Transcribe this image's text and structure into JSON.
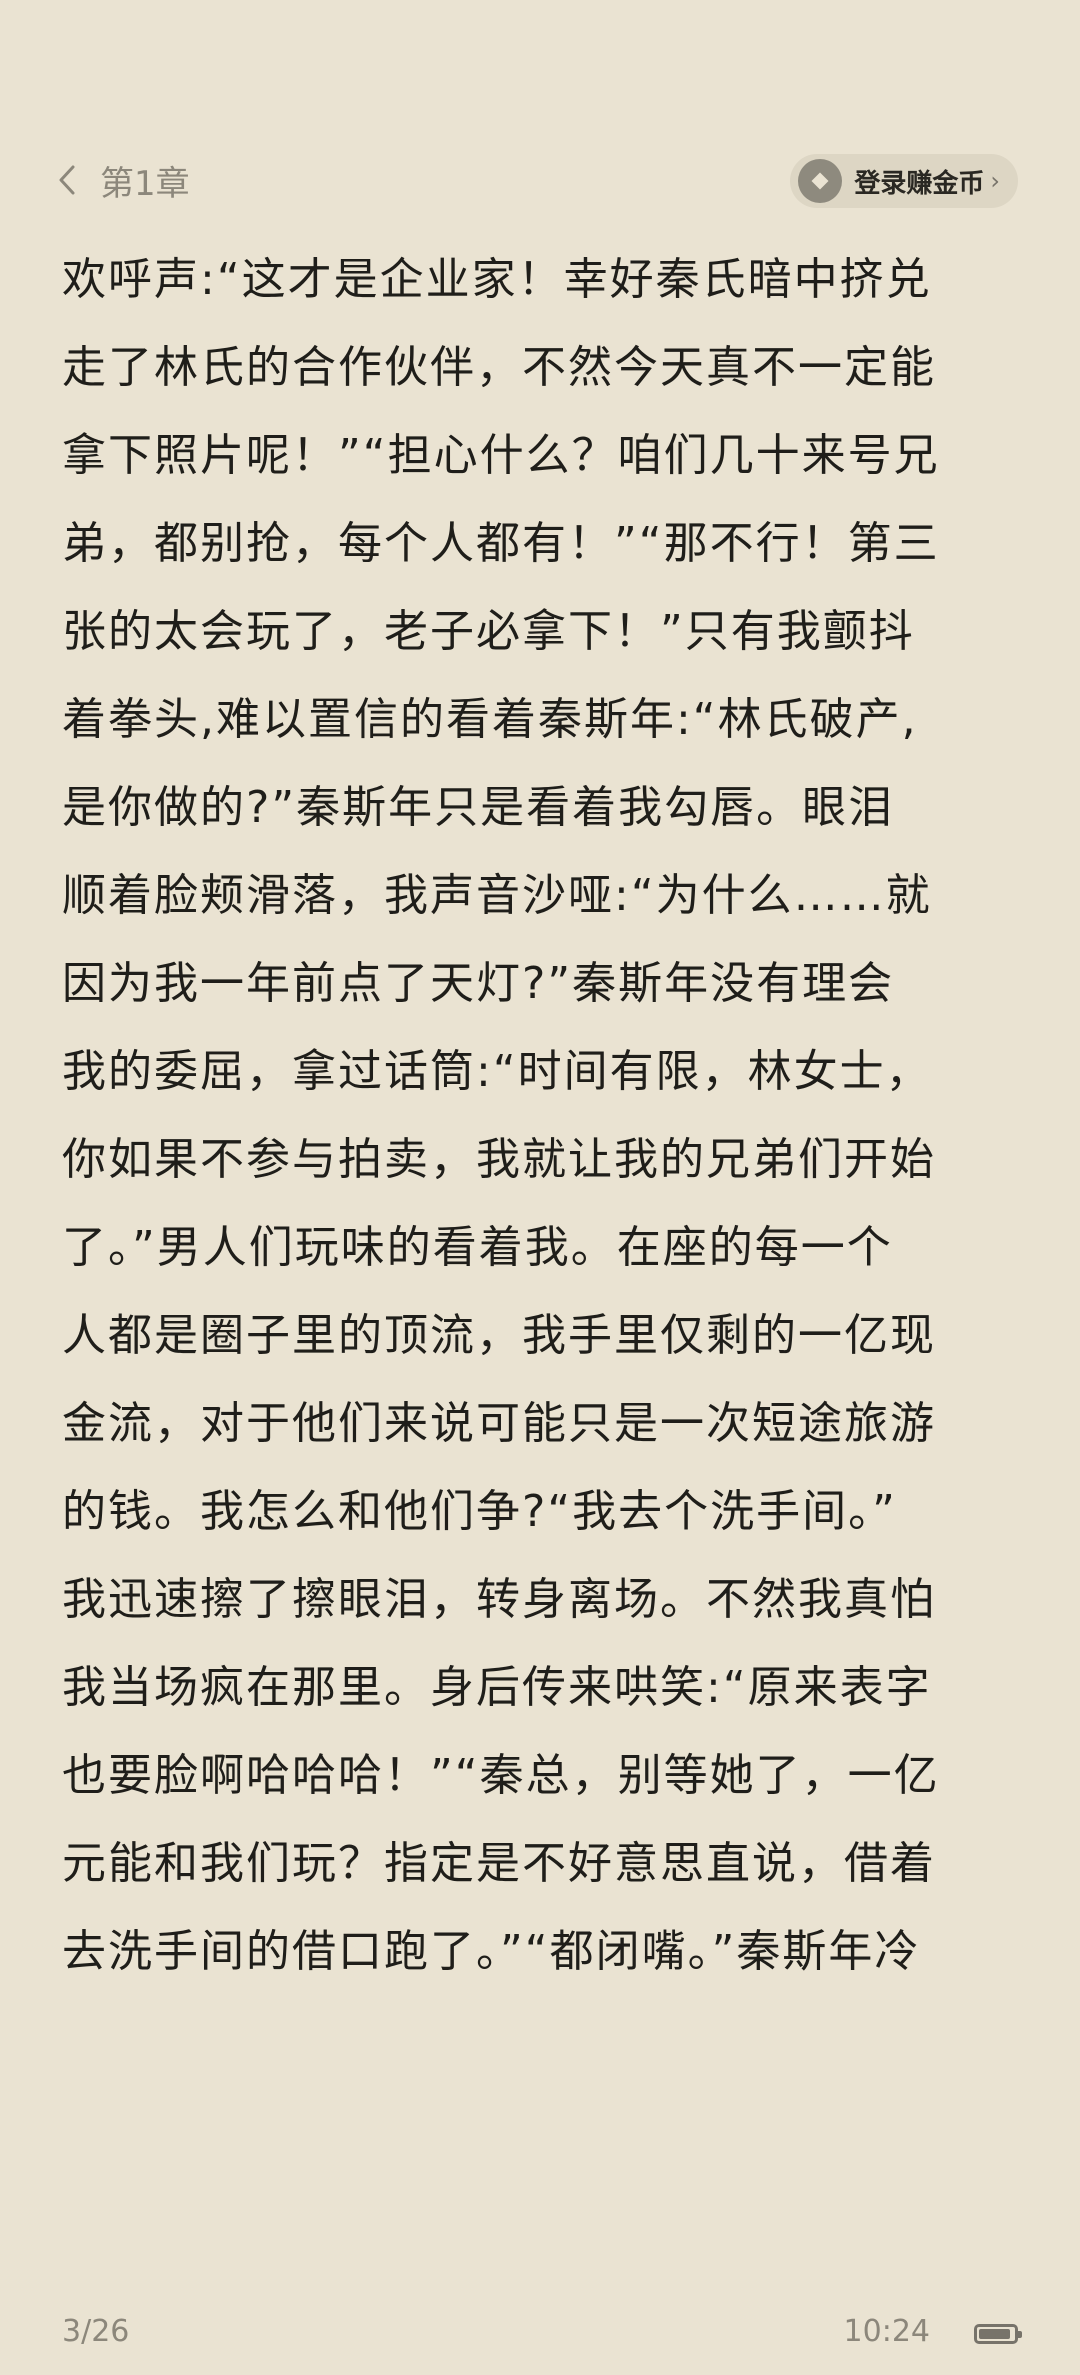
{
  "header": {
    "chapter_title": "第1章",
    "login_label": "登录赚金币",
    "login_chevron": "›"
  },
  "content": {
    "lines": [
      "欢呼声:“这才是企业家！幸好秦氏暗中挤兑",
      "走了林氏的合作伙伴，不然今天真不一定能",
      "拿下照片呢！”“担心什么？咱们几十来号兄",
      "弟，都别抢，每个人都有！”“那不行！第三",
      "张的太会玩了，老子必拿下！”只有我颤抖",
      "着拳头,难以置信的看着秦斯年:“林氏破产,",
      "是你做的?”秦斯年只是看着我勾唇。眼泪",
      "顺着脸颊滑落，我声音沙哑:“为什么……就",
      "因为我一年前点了天灯?”秦斯年没有理会",
      "我的委屈，拿过话筒:“时间有限，林女士，",
      "你如果不参与拍卖，我就让我的兄弟们开始",
      "了。”男人们玩味的看着我。在座的每一个",
      "人都是圈子里的顶流，我手里仅剩的一亿现",
      "金流，对于他们来说可能只是一次短途旅游",
      "的钱。我怎么和他们争?“我去个洗手间。”",
      "我迅速擦了擦眼泪，转身离场。不然我真怕",
      "我当场疯在那里。身后传来哄笑:“原来表字",
      "也要脸啊哈哈哈！”“秦总，别等她了，一亿",
      "元能和我们玩？指定是不好意思直说，借着",
      "去洗手间的借口跑了。”“都闭嘴。”秦斯年冷"
    ]
  },
  "footer": {
    "page_indicator": "3/26",
    "time": "10:24",
    "battery_level": 0.9
  },
  "colors": {
    "background": "#EAE3D2",
    "text": "#1F1E1A",
    "muted": "#8C877B",
    "pill": "#DDD6C4"
  },
  "icons": {
    "back": "chevron-left-icon",
    "coin": "coin-icon",
    "battery": "battery-icon"
  }
}
